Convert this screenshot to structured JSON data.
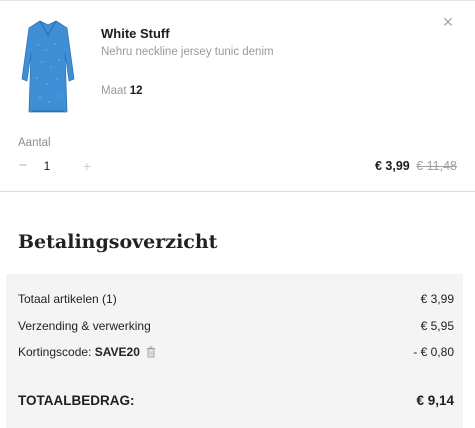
{
  "item": {
    "brand": "White Stuff",
    "name": "Nehru neckline jersey tunic denim",
    "size_label": "Maat",
    "size_value": "12",
    "close_icon": "×",
    "quantity_label": "Aantal",
    "quantity": "1",
    "minus": "−",
    "plus": "+",
    "price_current": "€ 3,99",
    "price_old": "€ 11,48"
  },
  "summary": {
    "title": "Betalingsoverzicht",
    "rows": [
      {
        "label": "Totaal artikelen (1)",
        "value": "€ 3,99"
      },
      {
        "label": "Verzending & verwerking",
        "value": "€ 5,95"
      }
    ],
    "discount": {
      "label": "Kortingscode:",
      "code": "SAVE20",
      "value": "- € 0,80"
    },
    "total_label": "TOTAALBEDRAG:",
    "total_value": "€ 9,14"
  },
  "colors": {
    "tunic": "#3f8fd6",
    "summary_background": "#f4f4f4"
  }
}
